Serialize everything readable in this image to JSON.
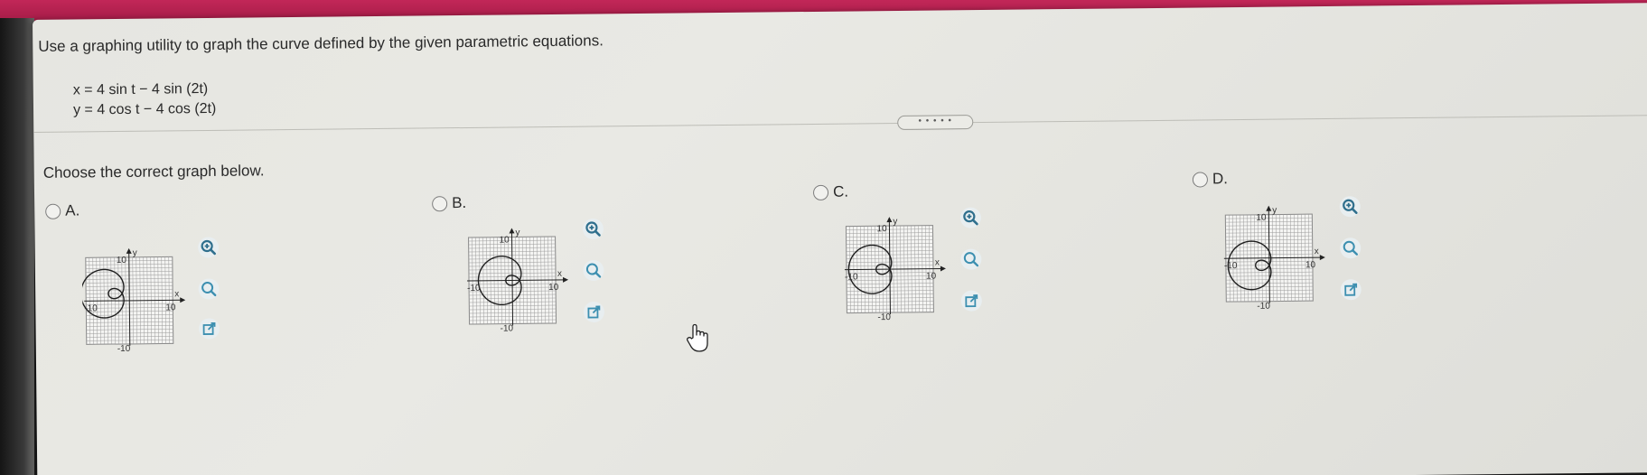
{
  "question": {
    "instruction": "Use a graphing utility to graph the curve defined by the given parametric equations.",
    "equation_x": "x = 4 sin t − 4 sin (2t)",
    "equation_y": "y = 4 cos t − 4 cos (2t)",
    "expand_label": "• • • • •",
    "prompt": "Choose the correct graph below."
  },
  "options": [
    {
      "letter": "A.",
      "selected": false,
      "x_label": "x",
      "y_label": "y",
      "tick_pos": "10",
      "tick_neg": "-10"
    },
    {
      "letter": "B.",
      "selected": false,
      "x_label": "x",
      "y_label": "y",
      "tick_pos": "10",
      "tick_neg": "-10"
    },
    {
      "letter": "C.",
      "selected": false,
      "x_label": "x",
      "y_label": "y",
      "tick_pos": "10",
      "tick_neg": "-10"
    },
    {
      "letter": "D.",
      "selected": false,
      "x_label": "x",
      "y_label": "y",
      "tick_pos": "10",
      "tick_neg": "-10"
    }
  ],
  "tools": {
    "zoom_in_icon": "zoom-in-icon",
    "zoom_out_icon": "zoom-out-icon",
    "popout_icon": "external-link-icon"
  },
  "colors": {
    "accent_teal": "#3c7d9a",
    "top_band": "#b0224f"
  }
}
